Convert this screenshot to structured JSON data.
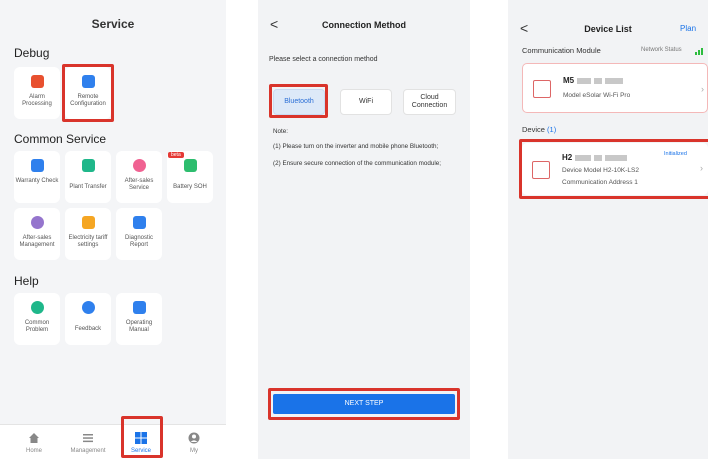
{
  "screen1": {
    "title": "Service",
    "sections": {
      "debug": "Debug",
      "common": "Common Service",
      "help": "Help"
    },
    "debug_items": [
      {
        "label": "Alarm Processing",
        "icon": "alarm-icon",
        "color": "#e8502f"
      },
      {
        "label": "Remote Configuration",
        "icon": "remote-config-icon",
        "color": "#2f80ed"
      }
    ],
    "common_items": [
      {
        "label": "Warranty Check",
        "icon": "warranty-icon",
        "color": "#2f80ed"
      },
      {
        "label": "Plant Transfer",
        "icon": "plant-transfer-icon",
        "color": "#1fb78a"
      },
      {
        "label": "After-sales Service",
        "icon": "heart-icon",
        "color": "#f06292"
      },
      {
        "label": "Battery SOH",
        "icon": "battery-icon",
        "color": "#2dbd6e",
        "badge": "beta"
      },
      {
        "label": "After-sales Management",
        "icon": "heart-icon",
        "color": "#9575cd"
      },
      {
        "label": "Electricity tariff settings",
        "icon": "tariff-icon",
        "color": "#f5a623"
      },
      {
        "label": "Diagnostic Report",
        "icon": "report-icon",
        "color": "#2f80ed"
      }
    ],
    "help_items": [
      {
        "label": "Common Problem",
        "icon": "question-icon",
        "color": "#1fb78a"
      },
      {
        "label": "Feedback",
        "icon": "feedback-icon",
        "color": "#2f80ed"
      },
      {
        "label": "Operating Manual",
        "icon": "manual-icon",
        "color": "#2f80ed"
      }
    ],
    "tabs": [
      {
        "label": "Home",
        "icon": "home-icon"
      },
      {
        "label": "Management",
        "icon": "list-icon"
      },
      {
        "label": "Service",
        "icon": "service-icon"
      },
      {
        "label": "My",
        "icon": "user-icon"
      }
    ]
  },
  "screen2": {
    "back": "<",
    "title": "Connection Method",
    "prompt": "Please select a connection method",
    "options": [
      "Bluetooth",
      "WiFi",
      "Cloud Connection"
    ],
    "selected": "Bluetooth",
    "note_title": "Note:",
    "note_1": "(1) Please turn on the inverter and mobile phone Bluetooth;",
    "note_2": "(2) Ensure secure connection of the communication module;",
    "next": "NEXT STEP"
  },
  "screen3": {
    "back": "<",
    "title": "Device List",
    "plan": "Plan",
    "comm_section": "Communication Module",
    "network_status": "Network Status",
    "module_name": "M5",
    "module_model": "Model  eSolar Wi-Fi Pro",
    "device_section": "Device",
    "device_count": "(1)",
    "device_name": "H2",
    "device_status": "Initialized",
    "device_model": "Device Model  H2-10K-LS2",
    "comm_address": "Communication Address  1"
  },
  "colors": {
    "highlight": "#d9342b",
    "accent": "#1a73e8"
  }
}
